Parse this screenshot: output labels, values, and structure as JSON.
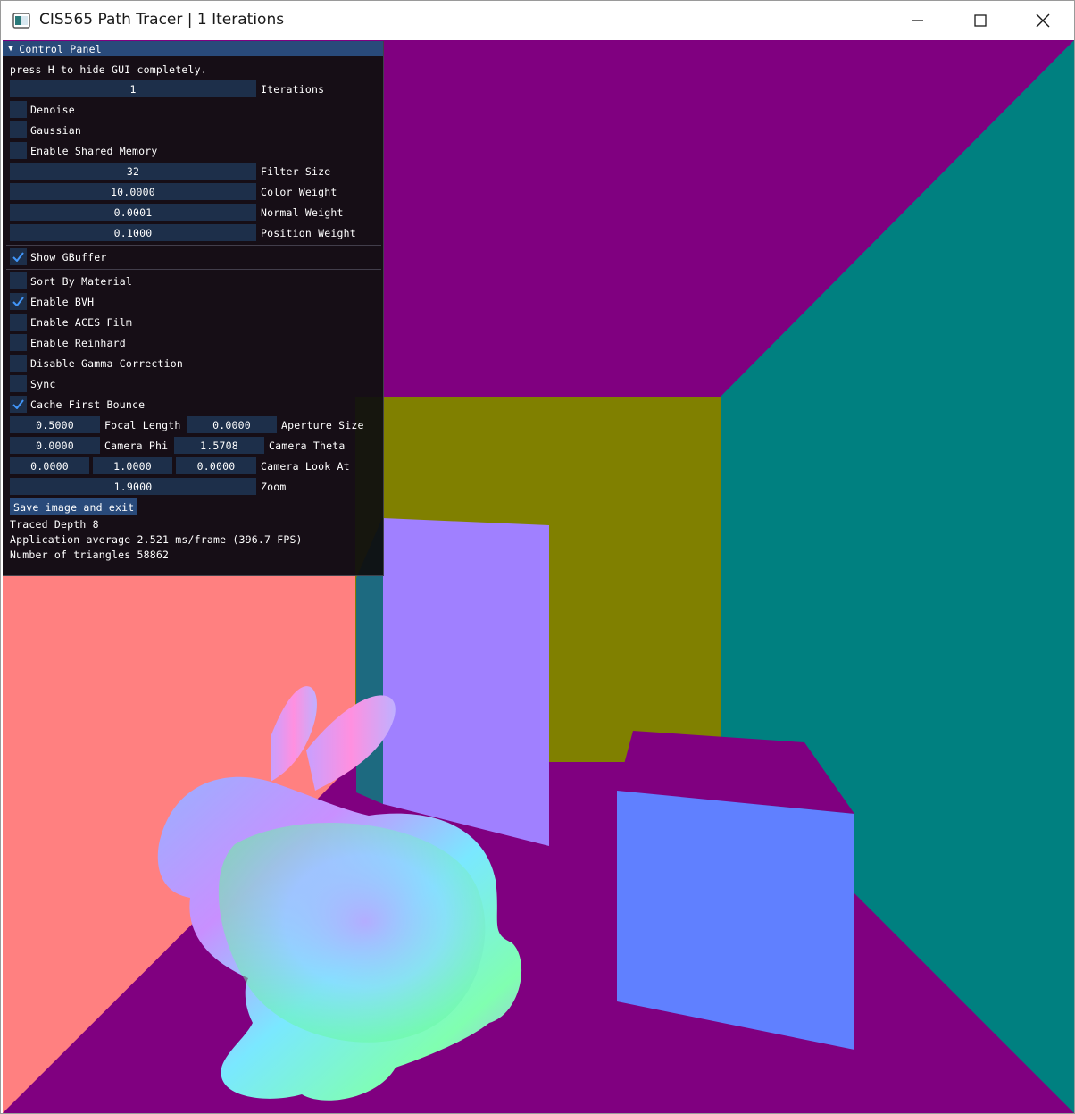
{
  "window": {
    "title": "CIS565 Path Tracer | 1 Iterations",
    "icon": "app-window-icon",
    "controls": [
      "minimize-icon",
      "maximize-icon",
      "close-icon"
    ]
  },
  "panel": {
    "title": "Control Panel",
    "hint": "press H to hide GUI completely.",
    "iterations": {
      "value": "1",
      "label": "Iterations"
    },
    "checkboxes_top": [
      {
        "label": "Denoise",
        "checked": false
      },
      {
        "label": "Gaussian",
        "checked": false
      },
      {
        "label": "Enable Shared Memory",
        "checked": false
      }
    ],
    "filter_size": {
      "value": "32",
      "label": "Filter Size"
    },
    "color_weight": {
      "value": "10.0000",
      "label": "Color Weight"
    },
    "normal_weight": {
      "value": "0.0001",
      "label": "Normal Weight"
    },
    "position_weight": {
      "value": "0.1000",
      "label": "Position Weight"
    },
    "show_gbuffer": {
      "label": "Show GBuffer",
      "checked": true
    },
    "checkboxes_bottom": [
      {
        "label": "Sort By Material",
        "checked": false
      },
      {
        "label": "Enable BVH",
        "checked": true
      },
      {
        "label": "Enable ACES Film",
        "checked": false
      },
      {
        "label": "Enable Reinhard",
        "checked": false
      },
      {
        "label": "Disable Gamma Correction",
        "checked": false
      },
      {
        "label": "Sync",
        "checked": false
      },
      {
        "label": "Cache First Bounce",
        "checked": true
      }
    ],
    "focal_length": {
      "value": "0.5000",
      "label": "Focal Length"
    },
    "aperture_size": {
      "value": "0.0000",
      "label": "Aperture Size"
    },
    "camera_phi": {
      "value": "0.0000",
      "label": "Camera Phi"
    },
    "camera_theta": {
      "value": "1.5708",
      "label": "Camera Theta"
    },
    "camera_look_at": {
      "x": "0.0000",
      "y": "1.0000",
      "z": "0.0000",
      "label": "Camera Look At"
    },
    "zoom": {
      "value": "1.9000",
      "label": "Zoom"
    },
    "save_button": "Save image and exit",
    "traced_depth": "Traced Depth 8",
    "app_average": "Application average 2.521 ms/frame (396.7 FPS)",
    "triangles": "Number of triangles 58862"
  },
  "colors": {
    "floor_ceiling": "#800080",
    "back_wall": "#808000",
    "right_wall": "#008080",
    "left_wall": "#ff8080",
    "tall_box_front": "#a080ff",
    "short_box_front": "#6080ff",
    "panel_header": "#294a7a",
    "frame_bg": "#1d2f4a",
    "check": "#4296fa"
  }
}
